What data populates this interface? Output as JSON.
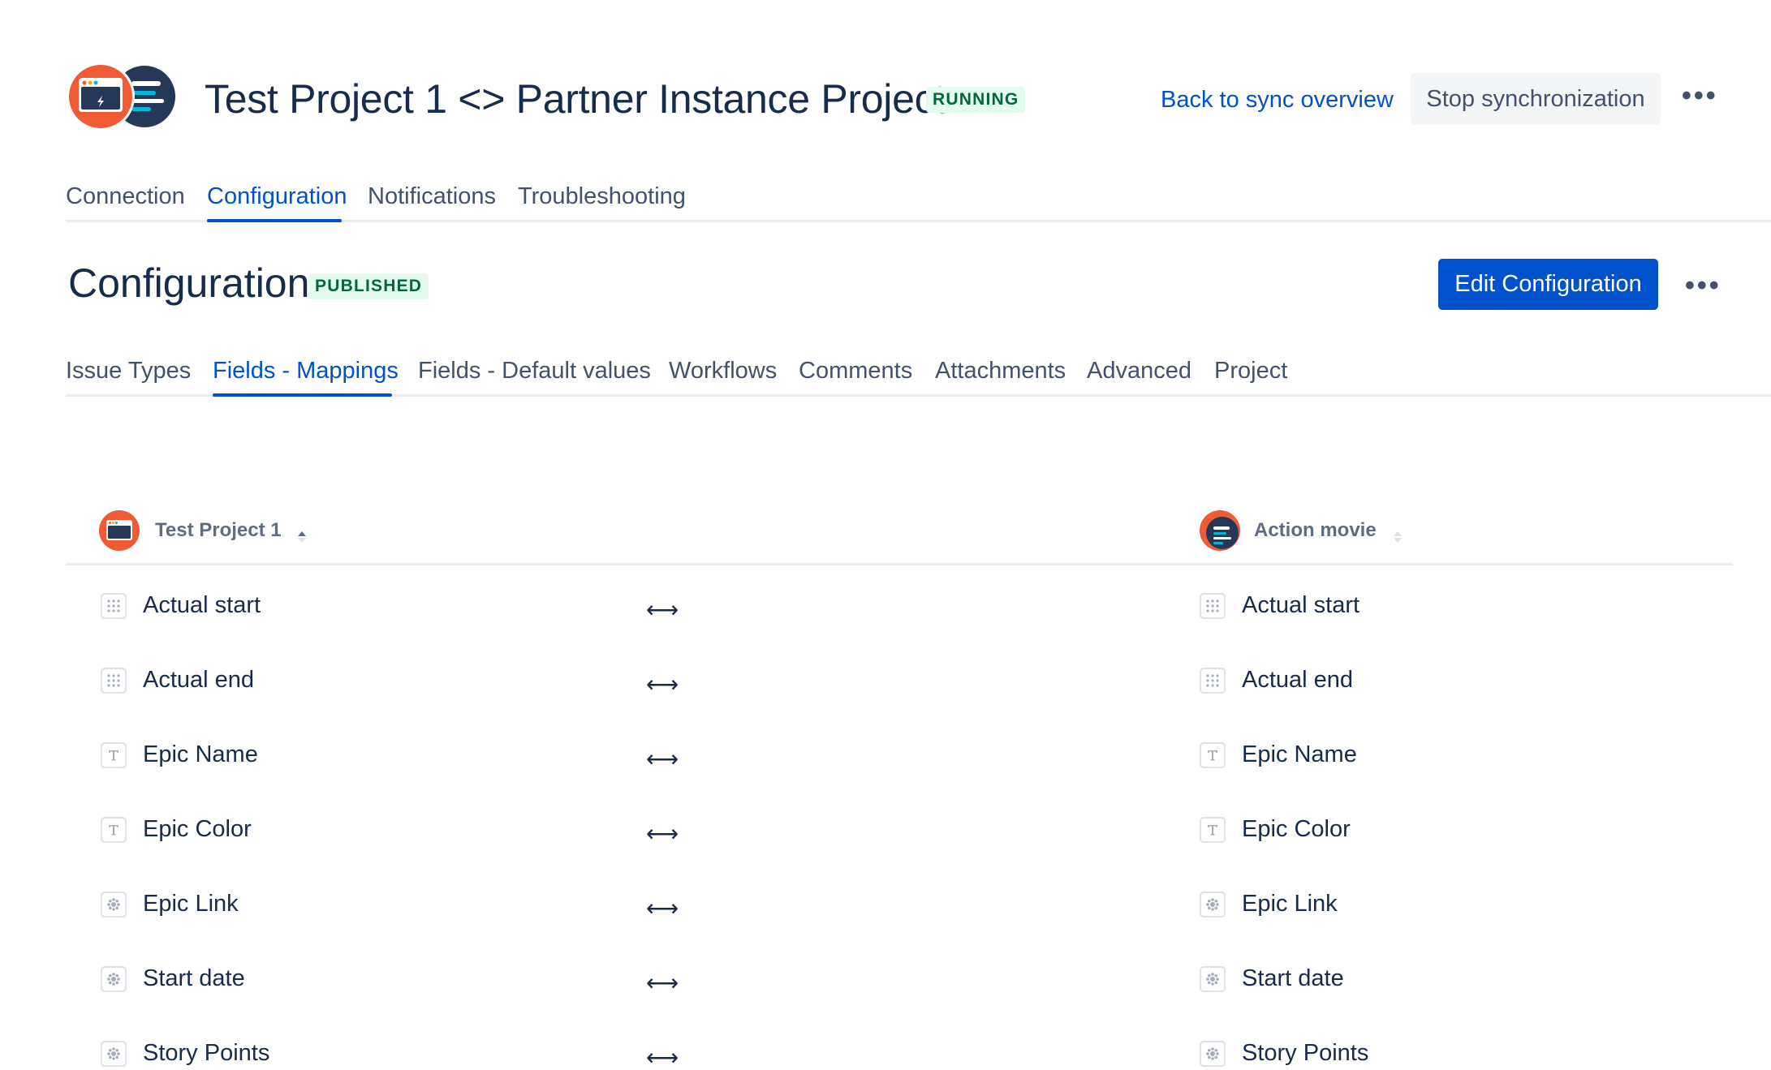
{
  "header": {
    "title": "Test Project 1 <> Partner Instance Project",
    "status": "RUNNING",
    "back_link": "Back to sync overview",
    "stop_button": "Stop synchronization",
    "more_label": "•••"
  },
  "tabs": [
    {
      "label": "Connection",
      "active": false
    },
    {
      "label": "Configuration",
      "active": true
    },
    {
      "label": "Notifications",
      "active": false
    },
    {
      "label": "Troubleshooting",
      "active": false
    }
  ],
  "configuration": {
    "title": "Configuration",
    "status": "PUBLISHED",
    "edit_button": "Edit Configuration",
    "more_label": "•••"
  },
  "subtabs": [
    {
      "label": "Issue Types",
      "active": false
    },
    {
      "label": "Fields - Mappings",
      "active": true
    },
    {
      "label": "Fields - Default values",
      "active": false
    },
    {
      "label": "Workflows",
      "active": false
    },
    {
      "label": "Comments",
      "active": false
    },
    {
      "label": "Attachments",
      "active": false
    },
    {
      "label": "Advanced",
      "active": false
    },
    {
      "label": "Project",
      "active": false
    }
  ],
  "table": {
    "left_header": "Test Project 1",
    "right_header": "Action movie",
    "arrow": "⟷",
    "rows": [
      {
        "left": "Actual start",
        "right": "Actual start",
        "icon": "grid-icon"
      },
      {
        "left": "Actual end",
        "right": "Actual end",
        "icon": "grid-icon"
      },
      {
        "left": "Epic Name",
        "right": "Epic Name",
        "icon": "text-field-icon"
      },
      {
        "left": "Epic Color",
        "right": "Epic Color",
        "icon": "text-field-icon"
      },
      {
        "left": "Epic Link",
        "right": "Epic Link",
        "icon": "custom-field-icon"
      },
      {
        "left": "Start date",
        "right": "Start date",
        "icon": "custom-field-icon"
      },
      {
        "left": "Story Points",
        "right": "Story Points",
        "icon": "custom-field-icon"
      }
    ]
  },
  "colors": {
    "accent": "#0052cc",
    "text": "#172b4d",
    "logo_orange": "#f05a35",
    "logo_navy": "#253858"
  }
}
